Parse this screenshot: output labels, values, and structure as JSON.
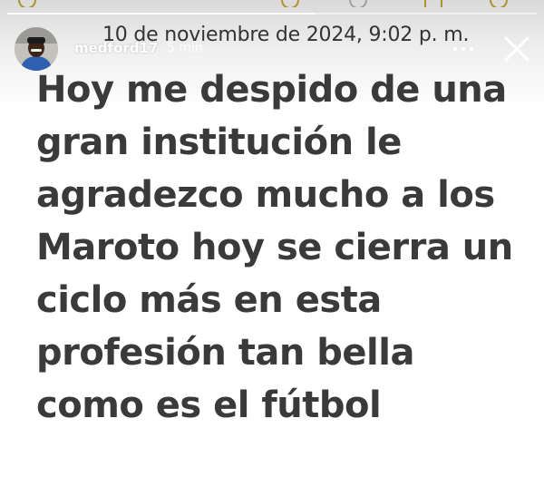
{
  "story": {
    "timestamp": "10 de noviembre de 2024, 9:02 p. m.",
    "username": "medford17",
    "time_ago": "5 min",
    "progress": 0.58,
    "lines": [
      "Hoy me despido de una",
      "gran institución le",
      "agradezco mucho a los",
      "Maroto  hoy se cierra un",
      "ciclo más en esta",
      "profesión tan bella",
      "como es el fútbol"
    ]
  },
  "icons": {
    "more": "more-horizontal-icon",
    "close": "close-icon"
  },
  "colors": {
    "text": "#3a3a3a",
    "background": "#ffffff",
    "overlay_text": "#ffffff"
  }
}
